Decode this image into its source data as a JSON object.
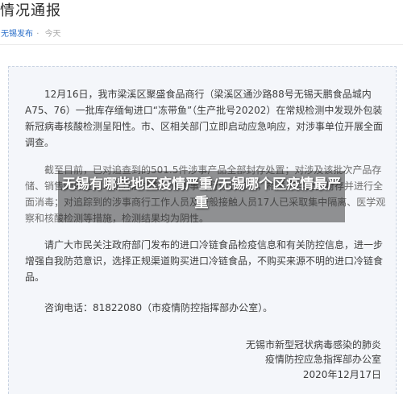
{
  "article": {
    "title": "情况通报",
    "source": "无锡发布",
    "dot": "·",
    "time": "今天"
  },
  "notice": {
    "paragraphs": [
      "12月16日，我市梁溪区聚盛食品商行（梁溪区通沙路88号无锡天鹏食品城内A75、76）一批库存缅甸进口“冻带鱼”（生产批号20202）在常规检测中发现外包装新冠病毒核酸检测呈阳性。市、区相关部门立即启动应急响应，对涉事单位开展全面调查。",
      "截至目前，已对追查到的501.5件涉事产品全部封存处置；对涉及该批次产品存储、销售的单位和场所开展排查，对涉事商行停业整顿，相关库存全部封存并进行全面消毒；对追踪到的涉事商行工作人员及一般接触人员17人已采取集中隔离、医学观察和核酸检测等措施，检测结果均为阴性。",
      "请广大市民关注政府部门发布的进口冷链食品检疫信息和有关防控信息，进一步增强自我防范意识，选择正规渠道购买进口冷链食品，不购买来源不明的进口冷链食品。"
    ],
    "phone": "咨询电话：81822080（市疫情防控指挥部办公室）。",
    "signature": {
      "org_line1": "无锡市新型冠状病毒感染的肺炎",
      "org_line2": "疫情防控应急指挥部办公室",
      "date": "2020年12月17日"
    }
  },
  "overlay": {
    "headline": "无锡有哪些地区疫情严重/无锡哪个区疫情最严重"
  }
}
